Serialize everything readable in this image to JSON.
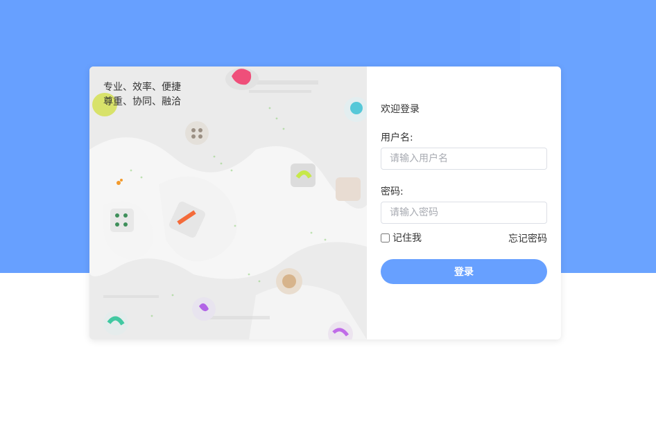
{
  "colors": {
    "primary": "#67a0ff",
    "card": "#ffffff",
    "text": "#333333"
  },
  "slogan": {
    "line1": "专业、效率、便捷",
    "line2": "尊重、协同、融洽"
  },
  "login": {
    "welcome": "欢迎登录",
    "username_label": "用户名:",
    "username_placeholder": "请输入用户名",
    "username_value": "",
    "password_label": "密码:",
    "password_placeholder": "请输入密码",
    "password_value": "",
    "remember_label": "记住我",
    "remember_checked": false,
    "forgot_label": "忘记密码",
    "submit_label": "登录"
  },
  "illustration": {
    "icon": "app-icons-pattern-image"
  }
}
